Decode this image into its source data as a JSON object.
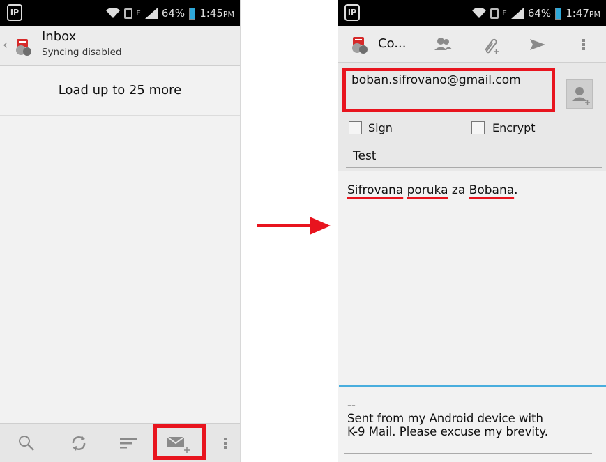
{
  "left_screen": {
    "status_bar": {
      "app_badge": "IP",
      "network_e": "E",
      "battery": "64%",
      "time": "1:45",
      "ampm": "PM"
    },
    "toolbar": {
      "title": "Inbox",
      "subtitle": "Syncing disabled"
    },
    "load_more_label": "Load up to 25 more",
    "bottom_actions": [
      "search-icon",
      "refresh-icon",
      "sort-icon",
      "compose-icon",
      "overflow-icon"
    ]
  },
  "right_screen": {
    "status_bar": {
      "app_badge": "IP",
      "network_e": "E",
      "battery": "64%",
      "time": "1:47",
      "ampm": "PM"
    },
    "toolbar": {
      "title": "Co...",
      "icons": [
        "contacts-icon",
        "attach-icon",
        "send-icon",
        "overflow-icon"
      ]
    },
    "to_field": {
      "value": "boban.sifrovano@gmail.com"
    },
    "sign_label": "Sign",
    "encrypt_label": "Encrypt",
    "subject": "Test",
    "body": {
      "word1": "Sifrovana",
      "word2": "poruka",
      "word3": "za",
      "word4": "Bobana",
      "end": "."
    },
    "signature": {
      "dashes": "--",
      "line1": "Sent from my Android device with",
      "line2": "K-9 Mail. Please excuse my brevity."
    }
  },
  "colors": {
    "highlight": "#e8141e",
    "arrow": "#e8141e",
    "focus_line": "#49aede",
    "status_bar": "#000000"
  }
}
